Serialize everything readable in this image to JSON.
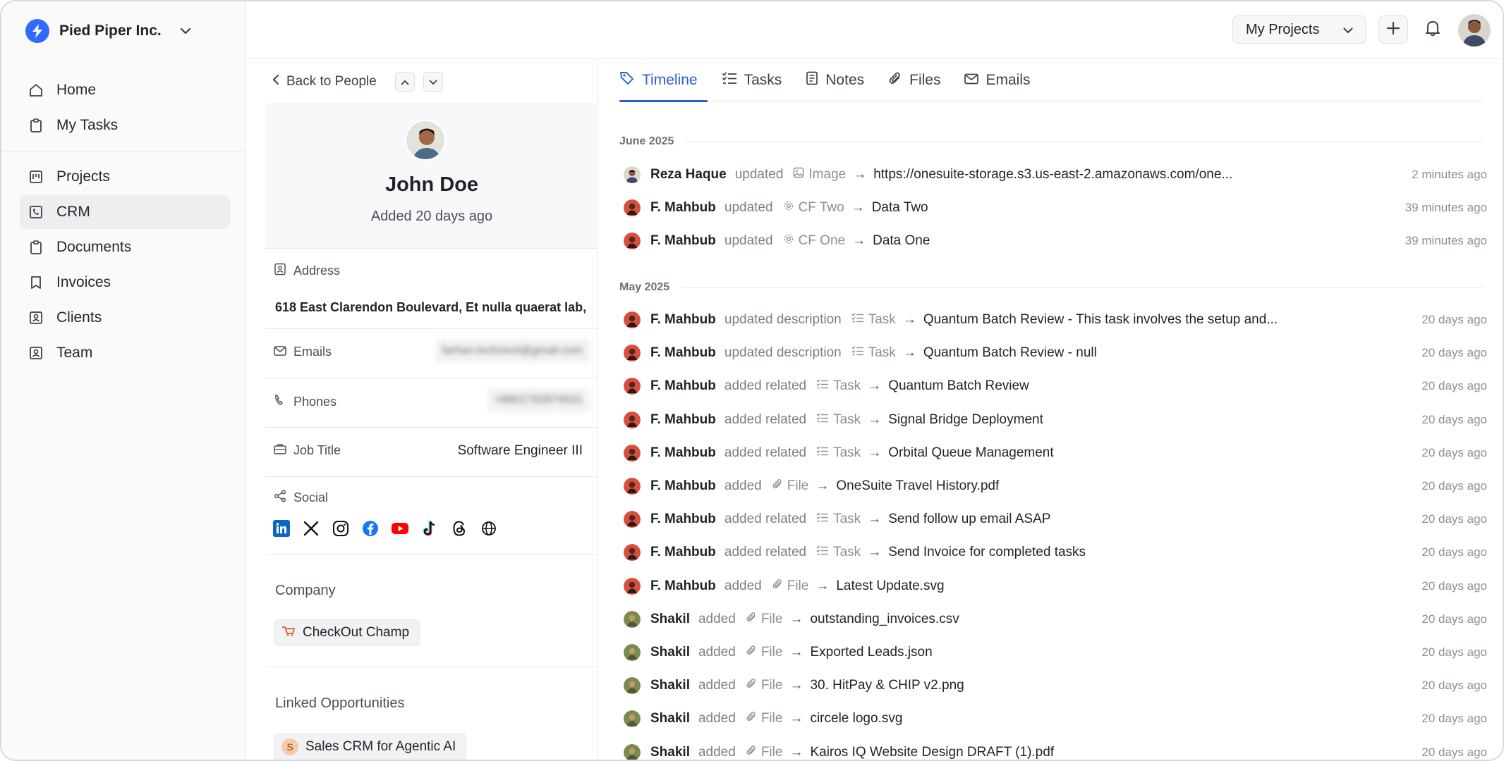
{
  "app": {
    "org_name": "Pied Piper Inc."
  },
  "sidebar": {
    "primary": [
      {
        "label": "Home",
        "icon": "home-icon"
      },
      {
        "label": "My Tasks",
        "icon": "clipboard-icon"
      }
    ],
    "secondary": [
      {
        "label": "Projects",
        "icon": "kanban-icon"
      },
      {
        "label": "CRM",
        "icon": "phone-card-icon",
        "active": true
      },
      {
        "label": "Documents",
        "icon": "clipboard-icon"
      },
      {
        "label": "Invoices",
        "icon": "bookmark-icon"
      },
      {
        "label": "Clients",
        "icon": "contact-icon"
      },
      {
        "label": "Team",
        "icon": "user-card-icon"
      }
    ]
  },
  "topbar": {
    "project_select": "My Projects"
  },
  "profile": {
    "back_label": "Back to People",
    "name": "John Doe",
    "added": "Added 20 days ago",
    "address_label": "Address",
    "address_value": "618 East Clarendon Boulevard, Et nulla quaerat lab,",
    "emails_label": "Emails",
    "emails_value": "farhan.technext@gmail.com",
    "phones_label": "Phones",
    "phones_value": "+8801792874931",
    "job_label": "Job Title",
    "job_value": "Software Engineer III",
    "social_label": "Social",
    "company_title": "Company",
    "company_name": "CheckOut Champ",
    "opps_title": "Linked Opportunities",
    "opp_name": "Sales CRM for Agentic AI",
    "opp_initial": "S"
  },
  "tabs": [
    {
      "label": "Timeline",
      "active": true
    },
    {
      "label": "Tasks"
    },
    {
      "label": "Notes"
    },
    {
      "label": "Files"
    },
    {
      "label": "Emails"
    }
  ],
  "timeline": {
    "june_label": "June 2025",
    "may_label": "May 2025",
    "june": [
      {
        "who": "Reza Haque",
        "action": "updated",
        "kind": "Image",
        "target": "https://onesuite-storage.s3.us-east-2.amazonaws.com/one...",
        "time": "2 minutes ago"
      },
      {
        "who": "F. Mahbub",
        "action": "updated",
        "kind": "CF Two",
        "target": "Data Two",
        "time": "39 minutes ago"
      },
      {
        "who": "F. Mahbub",
        "action": "updated",
        "kind": "CF One",
        "target": "Data One",
        "time": "39 minutes ago"
      }
    ],
    "may": [
      {
        "who": "F. Mahbub",
        "action": "updated description",
        "kind": "Task",
        "target": "Quantum Batch Review - This task involves the setup and...",
        "time": "20 days ago"
      },
      {
        "who": "F. Mahbub",
        "action": "updated description",
        "kind": "Task",
        "target": "Quantum Batch Review - null",
        "time": "20 days ago"
      },
      {
        "who": "F. Mahbub",
        "action": "added related",
        "kind": "Task",
        "target": "Quantum Batch Review",
        "time": "20 days ago"
      },
      {
        "who": "F. Mahbub",
        "action": "added related",
        "kind": "Task",
        "target": "Signal Bridge Deployment",
        "time": "20 days ago"
      },
      {
        "who": "F. Mahbub",
        "action": "added related",
        "kind": "Task",
        "target": "Orbital Queue Management",
        "time": "20 days ago"
      },
      {
        "who": "F. Mahbub",
        "action": "added",
        "kind": "File",
        "target": "OneSuite Travel History.pdf",
        "time": "20 days ago"
      },
      {
        "who": "F. Mahbub",
        "action": "added related",
        "kind": "Task",
        "target": "Send follow up email ASAP",
        "time": "20 days ago"
      },
      {
        "who": "F. Mahbub",
        "action": "added related",
        "kind": "Task",
        "target": "Send Invoice for completed tasks",
        "time": "20 days ago"
      },
      {
        "who": "F. Mahbub",
        "action": "added",
        "kind": "File",
        "target": "Latest Update.svg",
        "time": "20 days ago"
      },
      {
        "who": "Shakil",
        "action": "added",
        "kind": "File",
        "target": "outstanding_invoices.csv",
        "time": "20 days ago"
      },
      {
        "who": "Shakil",
        "action": "added",
        "kind": "File",
        "target": "Exported Leads.json",
        "time": "20 days ago"
      },
      {
        "who": "Shakil",
        "action": "added",
        "kind": "File",
        "target": "30. HitPay & CHIP v2.png",
        "time": "20 days ago"
      },
      {
        "who": "Shakil",
        "action": "added",
        "kind": "File",
        "target": "circele logo.svg",
        "time": "20 days ago"
      },
      {
        "who": "Shakil",
        "action": "added",
        "kind": "File",
        "target": "Kairos IQ Website Design DRAFT (1).pdf",
        "time": "20 days ago"
      }
    ]
  },
  "colors": {
    "accent": "#2d5bd0",
    "brand": "#2f6bff"
  }
}
